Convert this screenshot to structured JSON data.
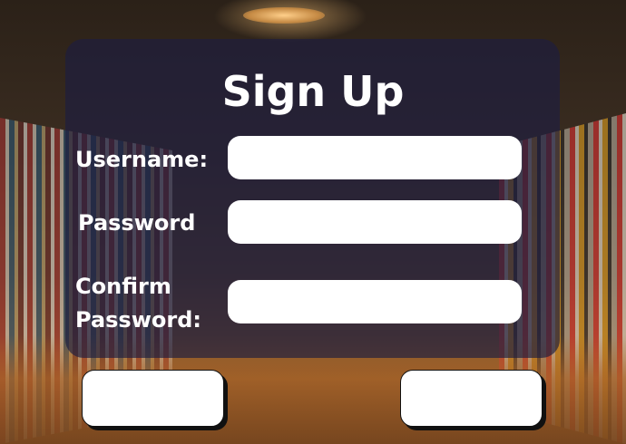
{
  "form": {
    "title": "Sign Up",
    "username_label": "Username:",
    "password_label": "Password",
    "confirm_label_line1": "Confirm",
    "confirm_label_line2": "Password:",
    "username_value": "",
    "password_value": "",
    "confirm_value": "",
    "left_button_label": "",
    "right_button_label": ""
  },
  "colors": {
    "panel": "#1e1e40",
    "text": "#ffffff",
    "field": "#ffffff"
  }
}
